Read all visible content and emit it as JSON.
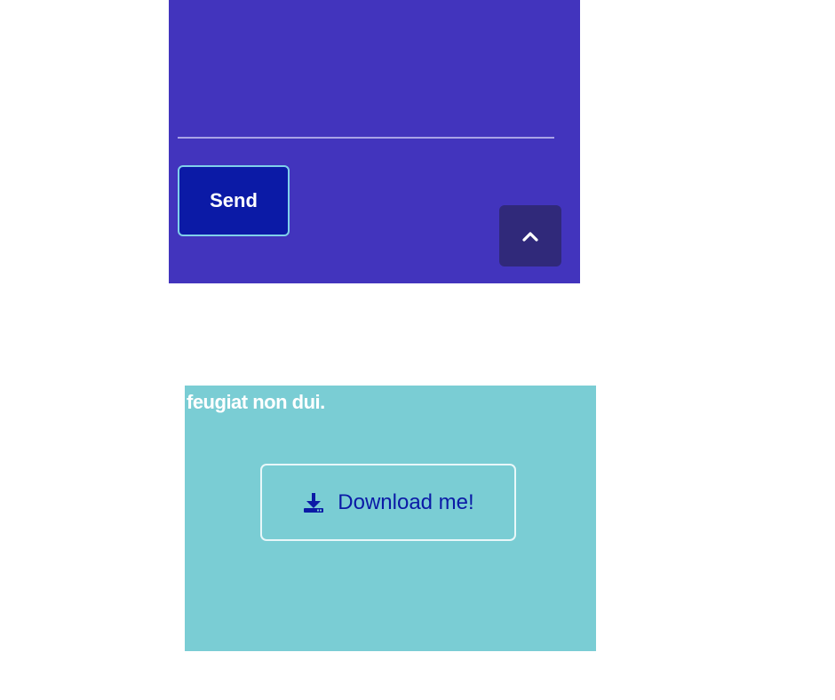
{
  "form": {
    "send_label": "Send",
    "back_to_top_icon": "chevron-up-icon"
  },
  "download_section": {
    "text": "feugiat non dui.",
    "button_label": "Download me!",
    "button_icon": "download-icon"
  },
  "colors": {
    "form_background": "#4234bd",
    "send_button": "#0b1aa6",
    "back_to_top": "#30297a",
    "download_background": "#7acdd4",
    "download_text": "#0b1aa6"
  }
}
